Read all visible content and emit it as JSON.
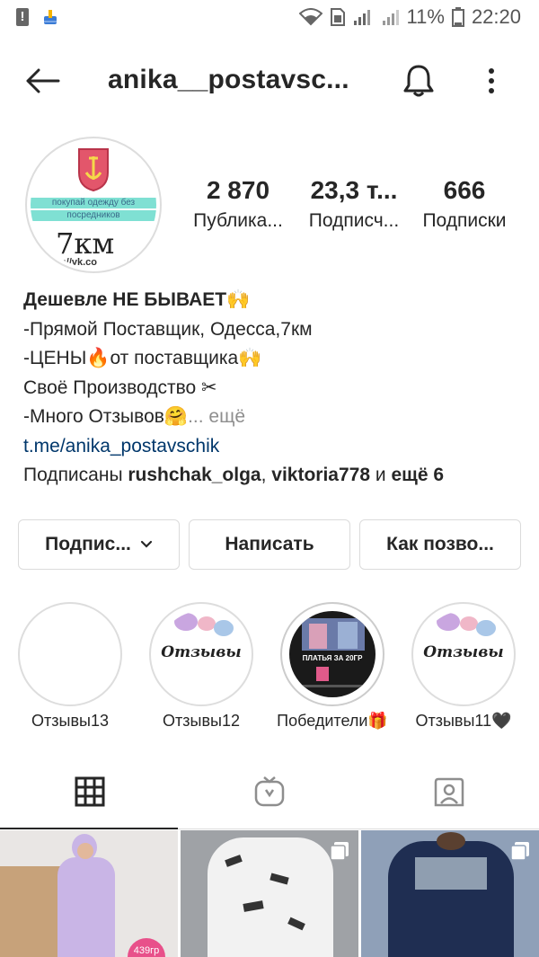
{
  "status_bar": {
    "battery": "11%",
    "time": "22:20"
  },
  "header": {
    "title": "anika__postavsc..."
  },
  "profile": {
    "avatar": {
      "line1": "покупай одежду без",
      "line2": "посредников",
      "line3": "7км",
      "line4": "s://vk.co"
    },
    "stats": [
      {
        "value": "2 870",
        "label": "Публика..."
      },
      {
        "value": "23,3 т...",
        "label": "Подписч..."
      },
      {
        "value": "666",
        "label": "Подписки"
      }
    ]
  },
  "bio": {
    "line1": "Дешевле НЕ БЫВАЕТ🙌",
    "line2": "-Прямой Поставщик, Одесса,7км",
    "line3": "-ЦЕНЫ🔥от поставщика🙌",
    "line4": "Своё Производство ✂",
    "line5": "-Много Отзывов🤗",
    "more": "... ещё",
    "link": "t.me/anika_postavschik",
    "followed_prefix": "Подписаны ",
    "followed_user1": "rushchak_olga",
    "followed_sep": ", ",
    "followed_user2": "viktoria778",
    "followed_and": " и ",
    "followed_more": "ещё 6"
  },
  "actions": {
    "follow": "Подпис...",
    "message": "Написать",
    "contact": "Как позво..."
  },
  "highlights": [
    {
      "label": "Отзывы13",
      "cover_text": ""
    },
    {
      "label": "Отзывы12",
      "cover_text": "Отзывы"
    },
    {
      "label": "Победители🎁",
      "cover_text": "ПЛАТЬЯ ЗА 20ГР"
    },
    {
      "label": "Отзывы11🖤",
      "cover_text": "Отзывы"
    }
  ],
  "tabs": [
    "grid-tab",
    "igtv-tab",
    "tagged-tab"
  ],
  "grid_posts": [
    {
      "badge": "439гр"
    },
    {
      "badge": ""
    },
    {
      "badge": ""
    }
  ]
}
